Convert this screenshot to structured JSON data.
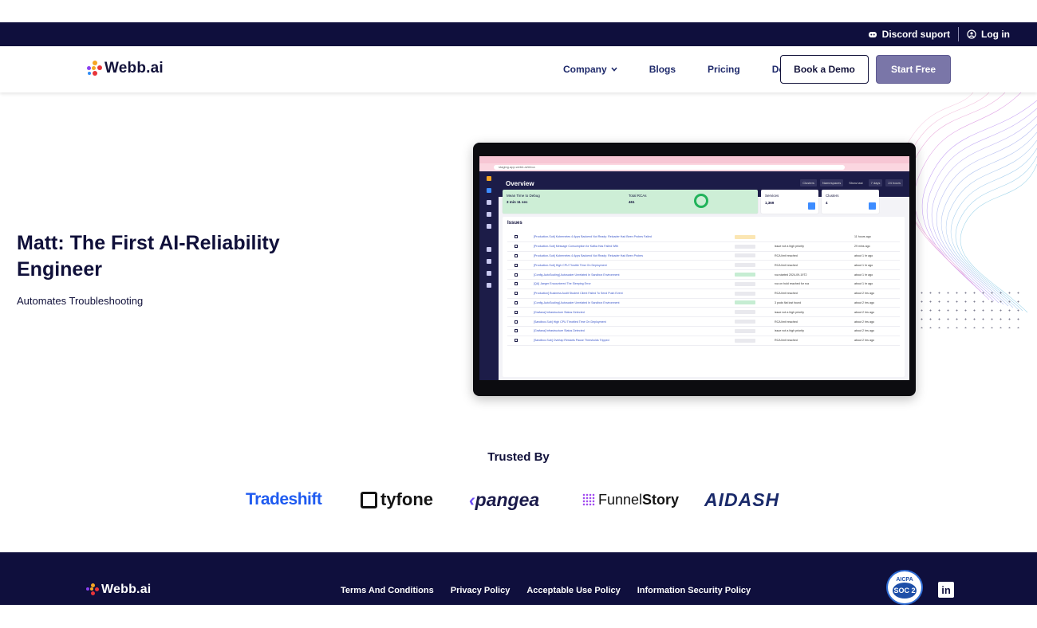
{
  "topbar": {
    "discord_label": "Discord suport",
    "discord_icon": "discord-icon",
    "login_label": "Log in",
    "login_icon": "user-circle-icon"
  },
  "brand": {
    "name": "Webb.ai",
    "colors": [
      "#f5a623",
      "#e8343a",
      "#8a3ff0",
      "#2f8cf5"
    ]
  },
  "nav": {
    "company": "Company",
    "blogs": "Blogs",
    "pricing": "Pricing",
    "docs": "Docs",
    "book_demo": "Book a Demo",
    "start_free": "Start Free"
  },
  "hero": {
    "title": "Matt: The First AI-Reliability Engineer",
    "subtitle": "Automates Troubleshooting"
  },
  "mockup": {
    "url": "staging.app.webb.ai/#/rca",
    "heading": "Overview",
    "controls": [
      "Clusters",
      "Namespaces",
      "Show last",
      "7 days",
      "24 hours"
    ],
    "mttd_label": "Mean Time to Debug",
    "mttd_value": "3 min 11 sec",
    "total_label": "Total RCAs",
    "total_value": "461",
    "services_label": "Services",
    "services_value": "1,369",
    "clusters_label": "Clusters",
    "clusters_value": "4",
    "issues_title": "Issues",
    "rows": [
      {
        "name": "[Production-Sub] Kubernetes 4 Apps Backend Not Ready: Reloader Had Been Probes Failed",
        "status": "y",
        "detail": "",
        "time": "11 hours ago"
      },
      {
        "name": "[Production-Sub] Message Consumption for Kafka Has Failed With",
        "status": "n",
        "detail": "issue not a high priority",
        "time": "29 mins ago"
      },
      {
        "name": "[Production-Sub] Kubernetes 4 Apps Backend Not Ready: Reloader Had Been Probes",
        "status": "n",
        "detail": "RCA limit reached",
        "time": "about 1 hr ago"
      },
      {
        "name": "[Production-Sub] High CPU Throttle Time On Deployment",
        "status": "n",
        "detail": "RCA limit reached",
        "time": "about 1 hr ago"
      },
      {
        "name": "[Config-AutoScaling] Autoscaler Unrelated In Sandbox Environment",
        "status": "g",
        "detail": "rca started 2024-09-19T2",
        "time": "about 1 hr ago"
      },
      {
        "name": "[QA] Jaeger Encountered The Sleeping Error",
        "status": "n",
        "detail": "rca on hold reached for rca",
        "time": "about 1 hr ago"
      },
      {
        "name": "[Production] Business Audit Student Client Failed To Send Push Event",
        "status": "n",
        "detail": "RCA limit reached",
        "time": "about 2 hrs ago"
      },
      {
        "name": "[Config-AutoScaling] Autoscaler Unrelated In Sandbox Environment",
        "status": "g",
        "detail": "3 pods flat lost found",
        "time": "about 2 hrs ago"
      },
      {
        "name": "[Grafana] Infrastructure Status Detected",
        "status": "n",
        "detail": "issue not a high priority",
        "time": "about 2 hrs ago"
      },
      {
        "name": "[Sandbox-Sub] High CPU Throttled Time On Deployment",
        "status": "n",
        "detail": "RCA limit reached",
        "time": "about 2 hrs ago"
      },
      {
        "name": "[Grafana] Infrastructure Status Detected",
        "status": "n",
        "detail": "issue not a high priority",
        "time": "about 2 hrs ago"
      },
      {
        "name": "[Sandbox-Sub] Overlap Restarts Pause Thresholds Tripped",
        "status": "n",
        "detail": "RCA limit reached",
        "time": "about 2 hrs ago"
      }
    ]
  },
  "trusted": {
    "title": "Trusted By",
    "logos": {
      "tradeshift": "Tradeshift",
      "tyfone": "tyfone",
      "pangea": "pangea",
      "funnel_a": "Funnel",
      "funnel_b": "Story",
      "aidash": "AIDASH"
    }
  },
  "footer": {
    "links": [
      "Terms And Conditions",
      "Privacy Policy",
      "Acceptable Use Policy",
      "Information Security Policy"
    ],
    "soc_top": "AICPA",
    "soc_main": "SOC 2",
    "linkedin": "in"
  }
}
